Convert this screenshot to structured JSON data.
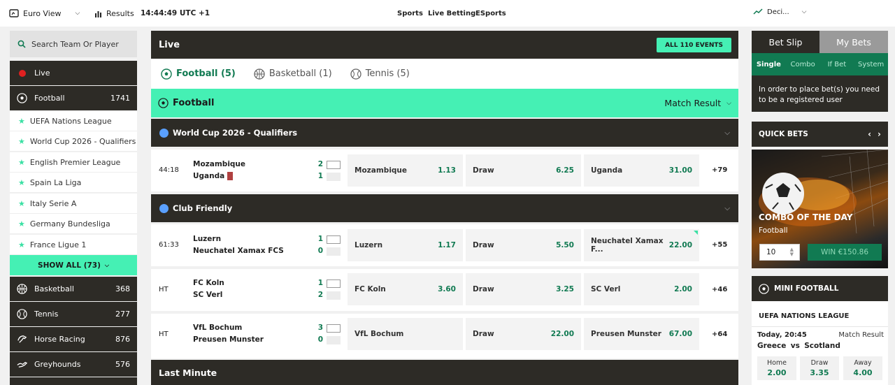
{
  "topbar": {
    "view": "Euro View",
    "results": "Results",
    "clock": "14:44:49 UTC +1",
    "nav": [
      "Sports",
      "Live Betting",
      "ESports"
    ],
    "odds_format": "Deci..."
  },
  "sidebar": {
    "search_placeholder": "Search Team Or Player",
    "live": "Live",
    "football": {
      "label": "Football",
      "count": "1741"
    },
    "leagues": [
      "UEFA Nations League",
      "World Cup 2026 - Qualifiers",
      "English Premier League",
      "Spain La Liga",
      "Italy Serie A",
      "Germany Bundesliga",
      "France Ligue 1"
    ],
    "show_all": "SHOW ALL (73)",
    "sports": [
      {
        "label": "Basketball",
        "count": "368"
      },
      {
        "label": "Tennis",
        "count": "277"
      },
      {
        "label": "Horse Racing",
        "count": "876"
      },
      {
        "label": "Greyhounds",
        "count": "576"
      }
    ]
  },
  "main": {
    "live_title": "Live",
    "all_events": "ALL 110 EVENTS",
    "tabs": [
      {
        "label": "Football (5)"
      },
      {
        "label": "Basketball (1)"
      },
      {
        "label": "Tennis (5)"
      }
    ],
    "sport_bar": {
      "label": "Football",
      "market": "Match Result"
    },
    "groups": [
      {
        "league": "World Cup 2026 - Qualifiers",
        "matches": [
          {
            "time": "44:18",
            "home": "Mozambique",
            "away": "Uganda",
            "hs": "2",
            "as": "1",
            "odds": [
              {
                "l": "Mozambique",
                "v": "1.13"
              },
              {
                "l": "Draw",
                "v": "6.25"
              },
              {
                "l": "Uganda",
                "v": "31.00"
              }
            ],
            "more": "+79"
          }
        ]
      },
      {
        "league": "Club Friendly",
        "matches": [
          {
            "time": "61:33",
            "home": "Luzern",
            "away": "Neuchatel Xamax FCS",
            "hs": "1",
            "as": "0",
            "odds": [
              {
                "l": "Luzern",
                "v": "1.17"
              },
              {
                "l": "Draw",
                "v": "5.50"
              },
              {
                "l": "Neuchatel Xamax F...",
                "v": "22.00"
              }
            ],
            "more": "+55"
          },
          {
            "time": "HT",
            "home": "FC Koln",
            "away": "SC Verl",
            "hs": "1",
            "as": "2",
            "odds": [
              {
                "l": "FC Koln",
                "v": "3.60"
              },
              {
                "l": "Draw",
                "v": "3.25"
              },
              {
                "l": "SC Verl",
                "v": "2.00"
              }
            ],
            "more": "+46"
          },
          {
            "time": "HT",
            "home": "VfL Bochum",
            "away": "Preusen Munster",
            "hs": "3",
            "as": "0",
            "odds": [
              {
                "l": "VfL Bochum",
                "v": ""
              },
              {
                "l": "Draw",
                "v": "22.00"
              },
              {
                "l": "Preusen Munster",
                "v": "67.00"
              }
            ],
            "more": "+64"
          }
        ]
      }
    ],
    "last_minute": "Last Minute"
  },
  "betslip": {
    "tabs": [
      "Bet Slip",
      "My Bets"
    ],
    "types": [
      "Single",
      "Combo",
      "If Bet",
      "System"
    ],
    "message": "In order to place bet(s) you need to be a registered user"
  },
  "quick_bets": {
    "title": "QUICK BETS",
    "combo_title": "COMBO OF THE DAY",
    "combo_sport": "Football",
    "stake": "10",
    "win": "WIN €150.86"
  },
  "mini_football": {
    "title": "MINI FOOTBALL",
    "league": "UEFA NATIONS LEAGUE",
    "when": "Today, 20:45",
    "market": "Match Result",
    "home": "Greece",
    "vs": "vs",
    "away": "Scotland",
    "odds": [
      {
        "l": "Home",
        "v": "2.00"
      },
      {
        "l": "Draw",
        "v": "3.35"
      },
      {
        "l": "Away",
        "v": "4.00"
      }
    ]
  }
}
